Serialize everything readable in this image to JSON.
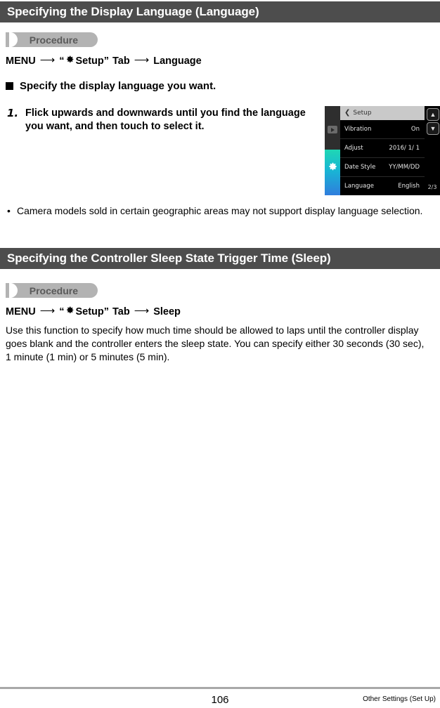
{
  "page": {
    "number": "106",
    "chapter_label": "Other Settings (Set Up)"
  },
  "sections": [
    {
      "heading": "Specifying the Display Language (Language)",
      "procedure_label": "Procedure",
      "menu_path": {
        "menu": "MENU",
        "arrow": "⟶",
        "quote_open": "“",
        "tab_icon": "gear-icon",
        "tab_label": "Setup",
        "quote_close": "”",
        "tab_word": "Tab",
        "target": "Language"
      },
      "sub_heading": "Specify the display language you want.",
      "steps": [
        {
          "number": "1.",
          "text": "Flick upwards and downwards until you find the language you want, and then touch to select it."
        }
      ],
      "notes": [
        {
          "bullet": "•",
          "text": "Camera models sold in certain geographic areas may not support display language selection."
        }
      ]
    },
    {
      "heading": "Specifying the Controller Sleep State Trigger Time (Sleep)",
      "procedure_label": "Procedure",
      "menu_path": {
        "menu": "MENU",
        "arrow": "⟶",
        "quote_open": "“",
        "tab_icon": "gear-icon",
        "tab_label": "Setup",
        "quote_close": "”",
        "tab_word": "Tab",
        "target": "Sleep"
      },
      "paragraph": "Use this function to specify how much time should be allowed to laps until the controller display goes blank and the controller enters the sleep state. You can specify either 30 seconds (30 sec), 1 minute (1 min)  or 5 minutes (5 min)."
    }
  ],
  "camera_screen": {
    "title": "Setup",
    "back_icon": "chevron-left-icon",
    "rail": {
      "play_icon": "play-icon",
      "setup_icon": "gear-icon"
    },
    "rows": [
      {
        "label": "Vibration",
        "value": "On"
      },
      {
        "label": "Adjust",
        "value": "2016/ 1/ 1"
      },
      {
        "label": "Date Style",
        "value": "YY/MM/DD"
      },
      {
        "label": "Language",
        "value": "English"
      }
    ],
    "nav": {
      "up_icon": "chevron-up-icon",
      "down_icon": "chevron-down-icon",
      "page_indicator": "2/3"
    }
  },
  "colors": {
    "header_bar": "#4d4d4d",
    "badge": "#b3b3b3",
    "footer_rule": "#a8a8a8"
  }
}
